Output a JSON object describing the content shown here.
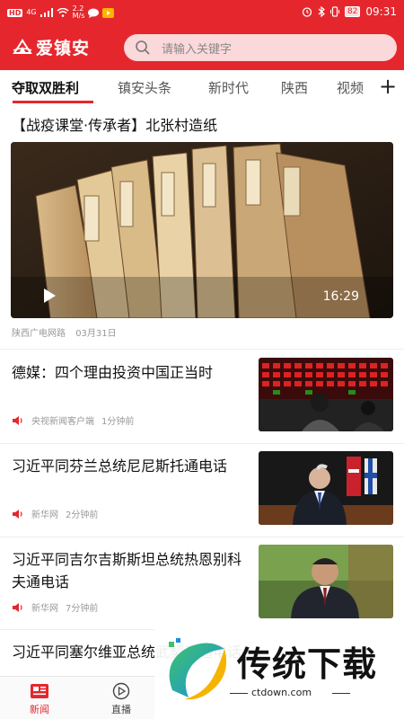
{
  "status_bar": {
    "hd": "HD",
    "net": "4G",
    "speed_value": "2.2",
    "speed_unit": "M/s",
    "battery": "82",
    "time": "09:31"
  },
  "header": {
    "app_name": "爱镇安",
    "search_placeholder": "请输入关键字",
    "brand_color": "#e5272d"
  },
  "tabs": {
    "items": [
      {
        "label": "夺取双胜利",
        "active": true
      },
      {
        "label": "镇安头条",
        "active": false
      },
      {
        "label": "新时代",
        "active": false
      },
      {
        "label": "陕西",
        "active": false
      },
      {
        "label": "视频",
        "active": false
      }
    ],
    "add_label": "+"
  },
  "feature": {
    "title": "【战疫课堂·传承者】北张村造纸",
    "duration": "16:29",
    "source": "陕西广电网路",
    "date": "03月31日"
  },
  "news": [
    {
      "title": "德媒：四个理由投资中国正当时",
      "source": "央视新闻客户端",
      "time": "1分钟前",
      "thumb": "stock-market"
    },
    {
      "title": "习近平同芬兰总统尼尼斯托通电话",
      "source": "新华网",
      "time": "2分钟前",
      "thumb": "finland-president"
    },
    {
      "title": "习近平同吉尔吉斯斯坦总统热恩别科夫通电话",
      "source": "新华网",
      "time": "7分钟前",
      "thumb": "kyrgyz-president"
    },
    {
      "title": "习近平同塞尔维亚总统武契奇通电话",
      "source": "",
      "time": "",
      "thumb": ""
    }
  ],
  "bottom_nav": {
    "items": [
      {
        "label": "新闻",
        "active": true,
        "icon": "news-icon"
      },
      {
        "label": "直播",
        "active": false,
        "icon": "live-icon"
      }
    ]
  },
  "watermark": {
    "text": "传统下载",
    "url": "ctdown.com"
  }
}
